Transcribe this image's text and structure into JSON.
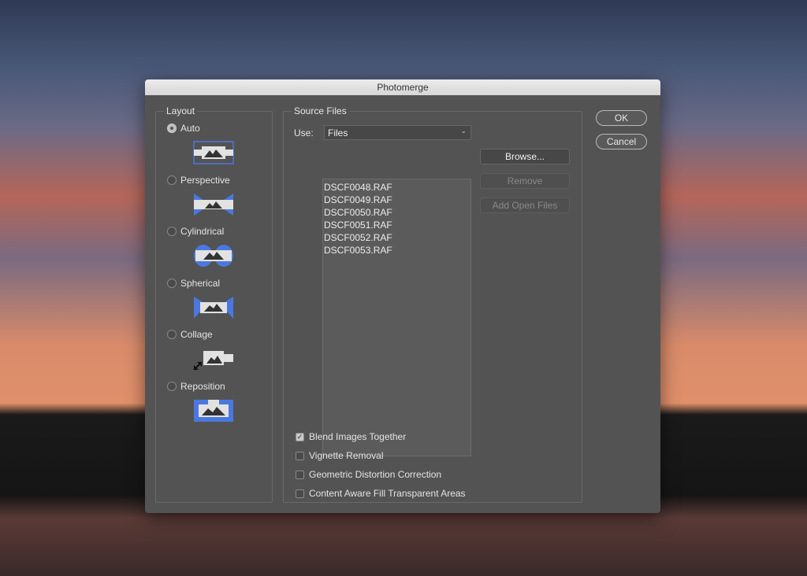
{
  "window": {
    "title": "Photomerge"
  },
  "layout": {
    "label": "Layout",
    "selected": "Auto",
    "options": [
      {
        "label": "Auto",
        "icon": "auto-layout-icon"
      },
      {
        "label": "Perspective",
        "icon": "perspective-layout-icon"
      },
      {
        "label": "Cylindrical",
        "icon": "cylindrical-layout-icon"
      },
      {
        "label": "Spherical",
        "icon": "spherical-layout-icon"
      },
      {
        "label": "Collage",
        "icon": "collage-layout-icon"
      },
      {
        "label": "Reposition",
        "icon": "reposition-layout-icon"
      }
    ]
  },
  "source": {
    "label": "Source Files",
    "use_label": "Use:",
    "use_value": "Files",
    "files": [
      "DSCF0048.RAF",
      "DSCF0049.RAF",
      "DSCF0050.RAF",
      "DSCF0051.RAF",
      "DSCF0052.RAF",
      "DSCF0053.RAF"
    ],
    "browse": "Browse...",
    "remove": "Remove",
    "add_open": "Add Open Files"
  },
  "options": [
    {
      "label": "Blend Images Together",
      "checked": true
    },
    {
      "label": "Vignette Removal",
      "checked": false
    },
    {
      "label": "Geometric Distortion Correction",
      "checked": false
    },
    {
      "label": "Content Aware Fill Transparent Areas",
      "checked": false
    }
  ],
  "buttons": {
    "ok": "OK",
    "cancel": "Cancel"
  },
  "colors": {
    "accent": "#4a78e0",
    "dialog": "#535353"
  }
}
